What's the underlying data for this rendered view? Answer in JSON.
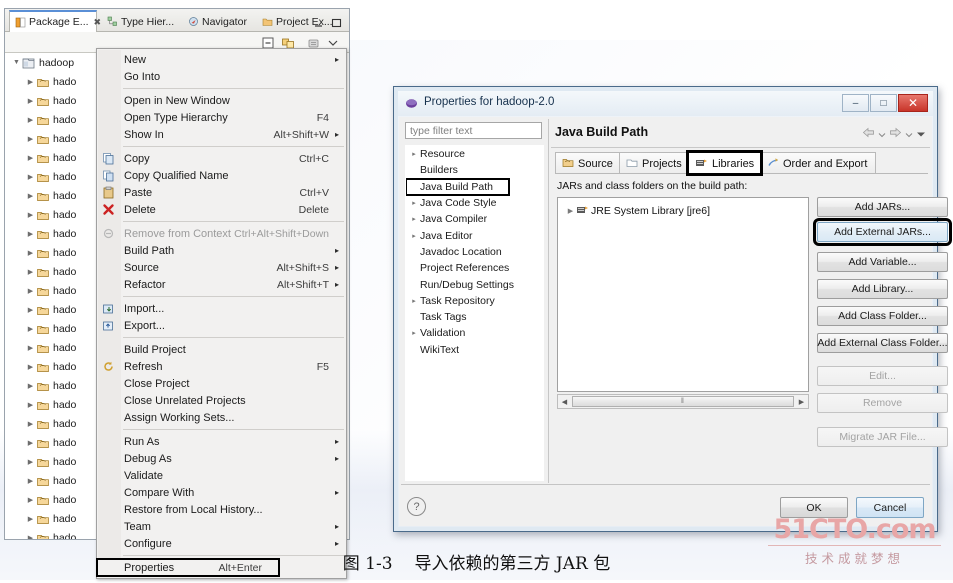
{
  "eclipse_view": {
    "tabs": [
      {
        "label": "Package E...",
        "icon": "package-explorer-icon",
        "active": true,
        "close": "✖"
      },
      {
        "label": "Type Hier...",
        "icon": "type-hierarchy-icon",
        "active": false
      },
      {
        "label": "Navigator",
        "icon": "navigator-icon",
        "active": false
      },
      {
        "label": "Project Ex...",
        "icon": "project-explorer-icon",
        "active": false
      }
    ],
    "window_controls": [
      "minimize-icon",
      "maximize-icon"
    ],
    "toolbar": [
      "collapse-all-icon",
      "link-with-editor-icon",
      "view-menu-icon",
      "view-dropdown-icon"
    ],
    "tree": {
      "root": {
        "label": "hadoop",
        "icon": "java-project-icon",
        "expanded": true
      },
      "children_label": "hado",
      "children_count": 25
    }
  },
  "context_menu": {
    "items": [
      {
        "label": "New",
        "accel": "",
        "submenu": true,
        "icon": "",
        "disabled": false
      },
      {
        "label": "Go Into",
        "accel": "",
        "submenu": false,
        "icon": "",
        "disabled": false
      },
      {
        "separator": true
      },
      {
        "label": "Open in New Window",
        "accel": "",
        "submenu": false,
        "icon": "",
        "disabled": false
      },
      {
        "label": "Open Type Hierarchy",
        "accel": "F4",
        "submenu": false,
        "icon": "",
        "disabled": false
      },
      {
        "label": "Show In",
        "accel": "Alt+Shift+W",
        "submenu": true,
        "icon": "",
        "disabled": false
      },
      {
        "separator": true
      },
      {
        "label": "Copy",
        "accel": "Ctrl+C",
        "submenu": false,
        "icon": "copy-icon",
        "disabled": false
      },
      {
        "label": "Copy Qualified Name",
        "accel": "",
        "submenu": false,
        "icon": "copy-qualified-icon",
        "disabled": false
      },
      {
        "label": "Paste",
        "accel": "Ctrl+V",
        "submenu": false,
        "icon": "paste-icon",
        "disabled": false
      },
      {
        "label": "Delete",
        "accel": "Delete",
        "submenu": false,
        "icon": "delete-icon",
        "disabled": false
      },
      {
        "separator": true
      },
      {
        "label": "Remove from Context",
        "accel": "Ctrl+Alt+Shift+Down",
        "submenu": false,
        "icon": "remove-context-icon",
        "disabled": true
      },
      {
        "label": "Build Path",
        "accel": "",
        "submenu": true,
        "icon": "",
        "disabled": false
      },
      {
        "label": "Source",
        "accel": "Alt+Shift+S",
        "submenu": true,
        "icon": "",
        "disabled": false
      },
      {
        "label": "Refactor",
        "accel": "Alt+Shift+T",
        "submenu": true,
        "icon": "",
        "disabled": false
      },
      {
        "separator": true
      },
      {
        "label": "Import...",
        "accel": "",
        "submenu": false,
        "icon": "import-icon",
        "disabled": false
      },
      {
        "label": "Export...",
        "accel": "",
        "submenu": false,
        "icon": "export-icon",
        "disabled": false
      },
      {
        "separator": true
      },
      {
        "label": "Build Project",
        "accel": "",
        "submenu": false,
        "icon": "",
        "disabled": false
      },
      {
        "label": "Refresh",
        "accel": "F5",
        "submenu": false,
        "icon": "refresh-icon",
        "disabled": false
      },
      {
        "label": "Close Project",
        "accel": "",
        "submenu": false,
        "icon": "",
        "disabled": false
      },
      {
        "label": "Close Unrelated Projects",
        "accel": "",
        "submenu": false,
        "icon": "",
        "disabled": false
      },
      {
        "label": "Assign Working Sets...",
        "accel": "",
        "submenu": false,
        "icon": "",
        "disabled": false
      },
      {
        "separator": true
      },
      {
        "label": "Run As",
        "accel": "",
        "submenu": true,
        "icon": "",
        "disabled": false
      },
      {
        "label": "Debug As",
        "accel": "",
        "submenu": true,
        "icon": "",
        "disabled": false
      },
      {
        "label": "Validate",
        "accel": "",
        "submenu": false,
        "icon": "",
        "disabled": false
      },
      {
        "label": "Compare With",
        "accel": "",
        "submenu": true,
        "icon": "",
        "disabled": false
      },
      {
        "label": "Restore from Local History...",
        "accel": "",
        "submenu": false,
        "icon": "",
        "disabled": false
      },
      {
        "label": "Team",
        "accel": "",
        "submenu": true,
        "icon": "",
        "disabled": false
      },
      {
        "label": "Configure",
        "accel": "",
        "submenu": true,
        "icon": "",
        "disabled": false
      },
      {
        "separator": true
      },
      {
        "label": "Properties",
        "accel": "Alt+Enter",
        "submenu": false,
        "icon": "",
        "disabled": false,
        "highlighted": true
      }
    ]
  },
  "dialog": {
    "title": "Properties for hadoop-2.0",
    "window_buttons": {
      "minimize": "–",
      "maximize": "□",
      "close": "✕"
    },
    "filter": {
      "placeholder": "type filter text",
      "value": ""
    },
    "nav_items": [
      {
        "label": "Resource",
        "expandable": true,
        "selected": false
      },
      {
        "label": "Builders",
        "expandable": false,
        "selected": false
      },
      {
        "label": "Java Build Path",
        "expandable": false,
        "selected": true
      },
      {
        "label": "Java Code Style",
        "expandable": true,
        "selected": false
      },
      {
        "label": "Java Compiler",
        "expandable": true,
        "selected": false
      },
      {
        "label": "Java Editor",
        "expandable": true,
        "selected": false
      },
      {
        "label": "Javadoc Location",
        "expandable": false,
        "selected": false
      },
      {
        "label": "Project References",
        "expandable": false,
        "selected": false
      },
      {
        "label": "Run/Debug Settings",
        "expandable": false,
        "selected": false
      },
      {
        "label": "Task Repository",
        "expandable": true,
        "selected": false
      },
      {
        "label": "Task Tags",
        "expandable": false,
        "selected": false
      },
      {
        "label": "Validation",
        "expandable": true,
        "selected": false
      },
      {
        "label": "WikiText",
        "expandable": false,
        "selected": false
      }
    ],
    "pane_title": "Java Build Path",
    "pane_nav_icons": [
      "back-arrow-icon",
      "back-dropdown-icon",
      "forward-arrow-icon",
      "forward-dropdown-icon",
      "view-menu-icon"
    ],
    "tabs": [
      {
        "label": "Source",
        "icon": "source-folder-icon",
        "active": false,
        "highlighted": false
      },
      {
        "label": "Projects",
        "icon": "projects-icon",
        "active": false,
        "highlighted": false
      },
      {
        "label": "Libraries",
        "icon": "libraries-icon",
        "active": true,
        "highlighted": true
      },
      {
        "label": "Order and Export",
        "icon": "order-export-icon",
        "active": false,
        "highlighted": false
      }
    ],
    "jars_label": "JARs and class folders on the build path:",
    "jars_list": [
      {
        "label": "JRE System Library [jre6]",
        "icon": "jre-library-icon",
        "expandable": true
      }
    ],
    "side_buttons": [
      {
        "label": "Add JARs...",
        "disabled": false,
        "highlighted": false
      },
      {
        "label": "Add External JARs...",
        "disabled": false,
        "highlighted": true
      },
      {
        "label": "Add Variable...",
        "disabled": false,
        "highlighted": false
      },
      {
        "label": "Add Library...",
        "disabled": false,
        "highlighted": false
      },
      {
        "label": "Add Class Folder...",
        "disabled": false,
        "highlighted": false
      },
      {
        "label": "Add External Class Folder...",
        "disabled": false,
        "highlighted": false
      },
      {
        "label": "Edit...",
        "disabled": true,
        "highlighted": false
      },
      {
        "label": "Remove",
        "disabled": true,
        "highlighted": false
      },
      {
        "label": "Migrate JAR File...",
        "disabled": true,
        "highlighted": false
      }
    ],
    "help_icon": "?",
    "ok_label": "OK",
    "cancel_label": "Cancel",
    "scrollbar_thumb_glyph": "‖"
  },
  "watermark": {
    "main": "51CTO.com",
    "sub": "技术成就梦想",
    "color": "#e8a6a6"
  },
  "caption": {
    "figure_no": "图 1-3",
    "text": "导入依赖的第三方 JAR 包"
  }
}
